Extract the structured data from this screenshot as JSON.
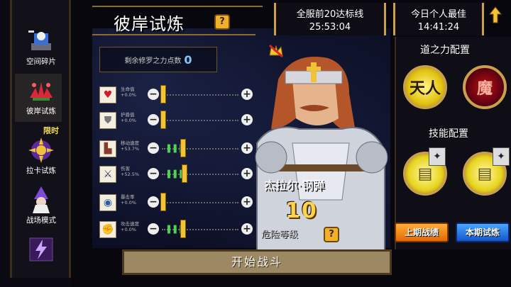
{
  "sidebar": {
    "items": [
      {
        "label": "空间碎片",
        "icon": "space-shard-icon"
      },
      {
        "label": "彼岸试炼",
        "icon": "red-spider-lily-icon"
      },
      {
        "label": "拉卡试炼",
        "icon": "laka-emblem-icon"
      },
      {
        "label": "战场模式",
        "icon": "wizard-icon"
      },
      {
        "label": "",
        "icon": "lightning-icon"
      }
    ],
    "limited_badge": "限时"
  },
  "page": {
    "title": "彼岸试炼",
    "help_label": "?",
    "points_label": "剩余修罗之力点数",
    "points_value": "0"
  },
  "stats": [
    {
      "name": "生命值",
      "value": "+0.0%",
      "icon": "heart-icon"
    },
    {
      "name": "护盾值",
      "value": "+0.0%",
      "icon": "shield-icon"
    },
    {
      "name": "移动速度",
      "value": "+53.7%",
      "icon": "boot-icon"
    },
    {
      "name": "伤害",
      "value": "+52.5%",
      "icon": "sword-icon"
    },
    {
      "name": "暴击率",
      "value": "+0.0%",
      "icon": "eye-icon"
    },
    {
      "name": "攻击速度",
      "value": "+0.0%",
      "icon": "gauntlet-icon"
    }
  ],
  "banners": {
    "server_top20": {
      "title": "全服前20达标线",
      "time": "25:53:04"
    },
    "personal_best": {
      "title": "今日个人最佳",
      "time": "14:41:24"
    }
  },
  "hero": {
    "name": "杰拉尔·钢弹",
    "level": "10",
    "danger_label": "危险等级",
    "danger_help": "?"
  },
  "right": {
    "dao_config": "道之力配置",
    "skill_config": "技能配置",
    "dao_orb_1": "天人",
    "dao_orb_2": "魔",
    "last_battle_label": "上期战绩",
    "trial_label": "本期试炼"
  },
  "actions": {
    "start_battle": "开始战斗"
  },
  "icons": {
    "help": "help-icon",
    "crown": "crossed-crown-icon",
    "back": "back-arrow-icon"
  },
  "colors": {
    "accent_gold": "#caa14a",
    "points_blue": "#7fc7ff",
    "level_yellow": "#ffd24a",
    "btn_orange": "#e46a00",
    "btn_blue": "#1556c9"
  }
}
